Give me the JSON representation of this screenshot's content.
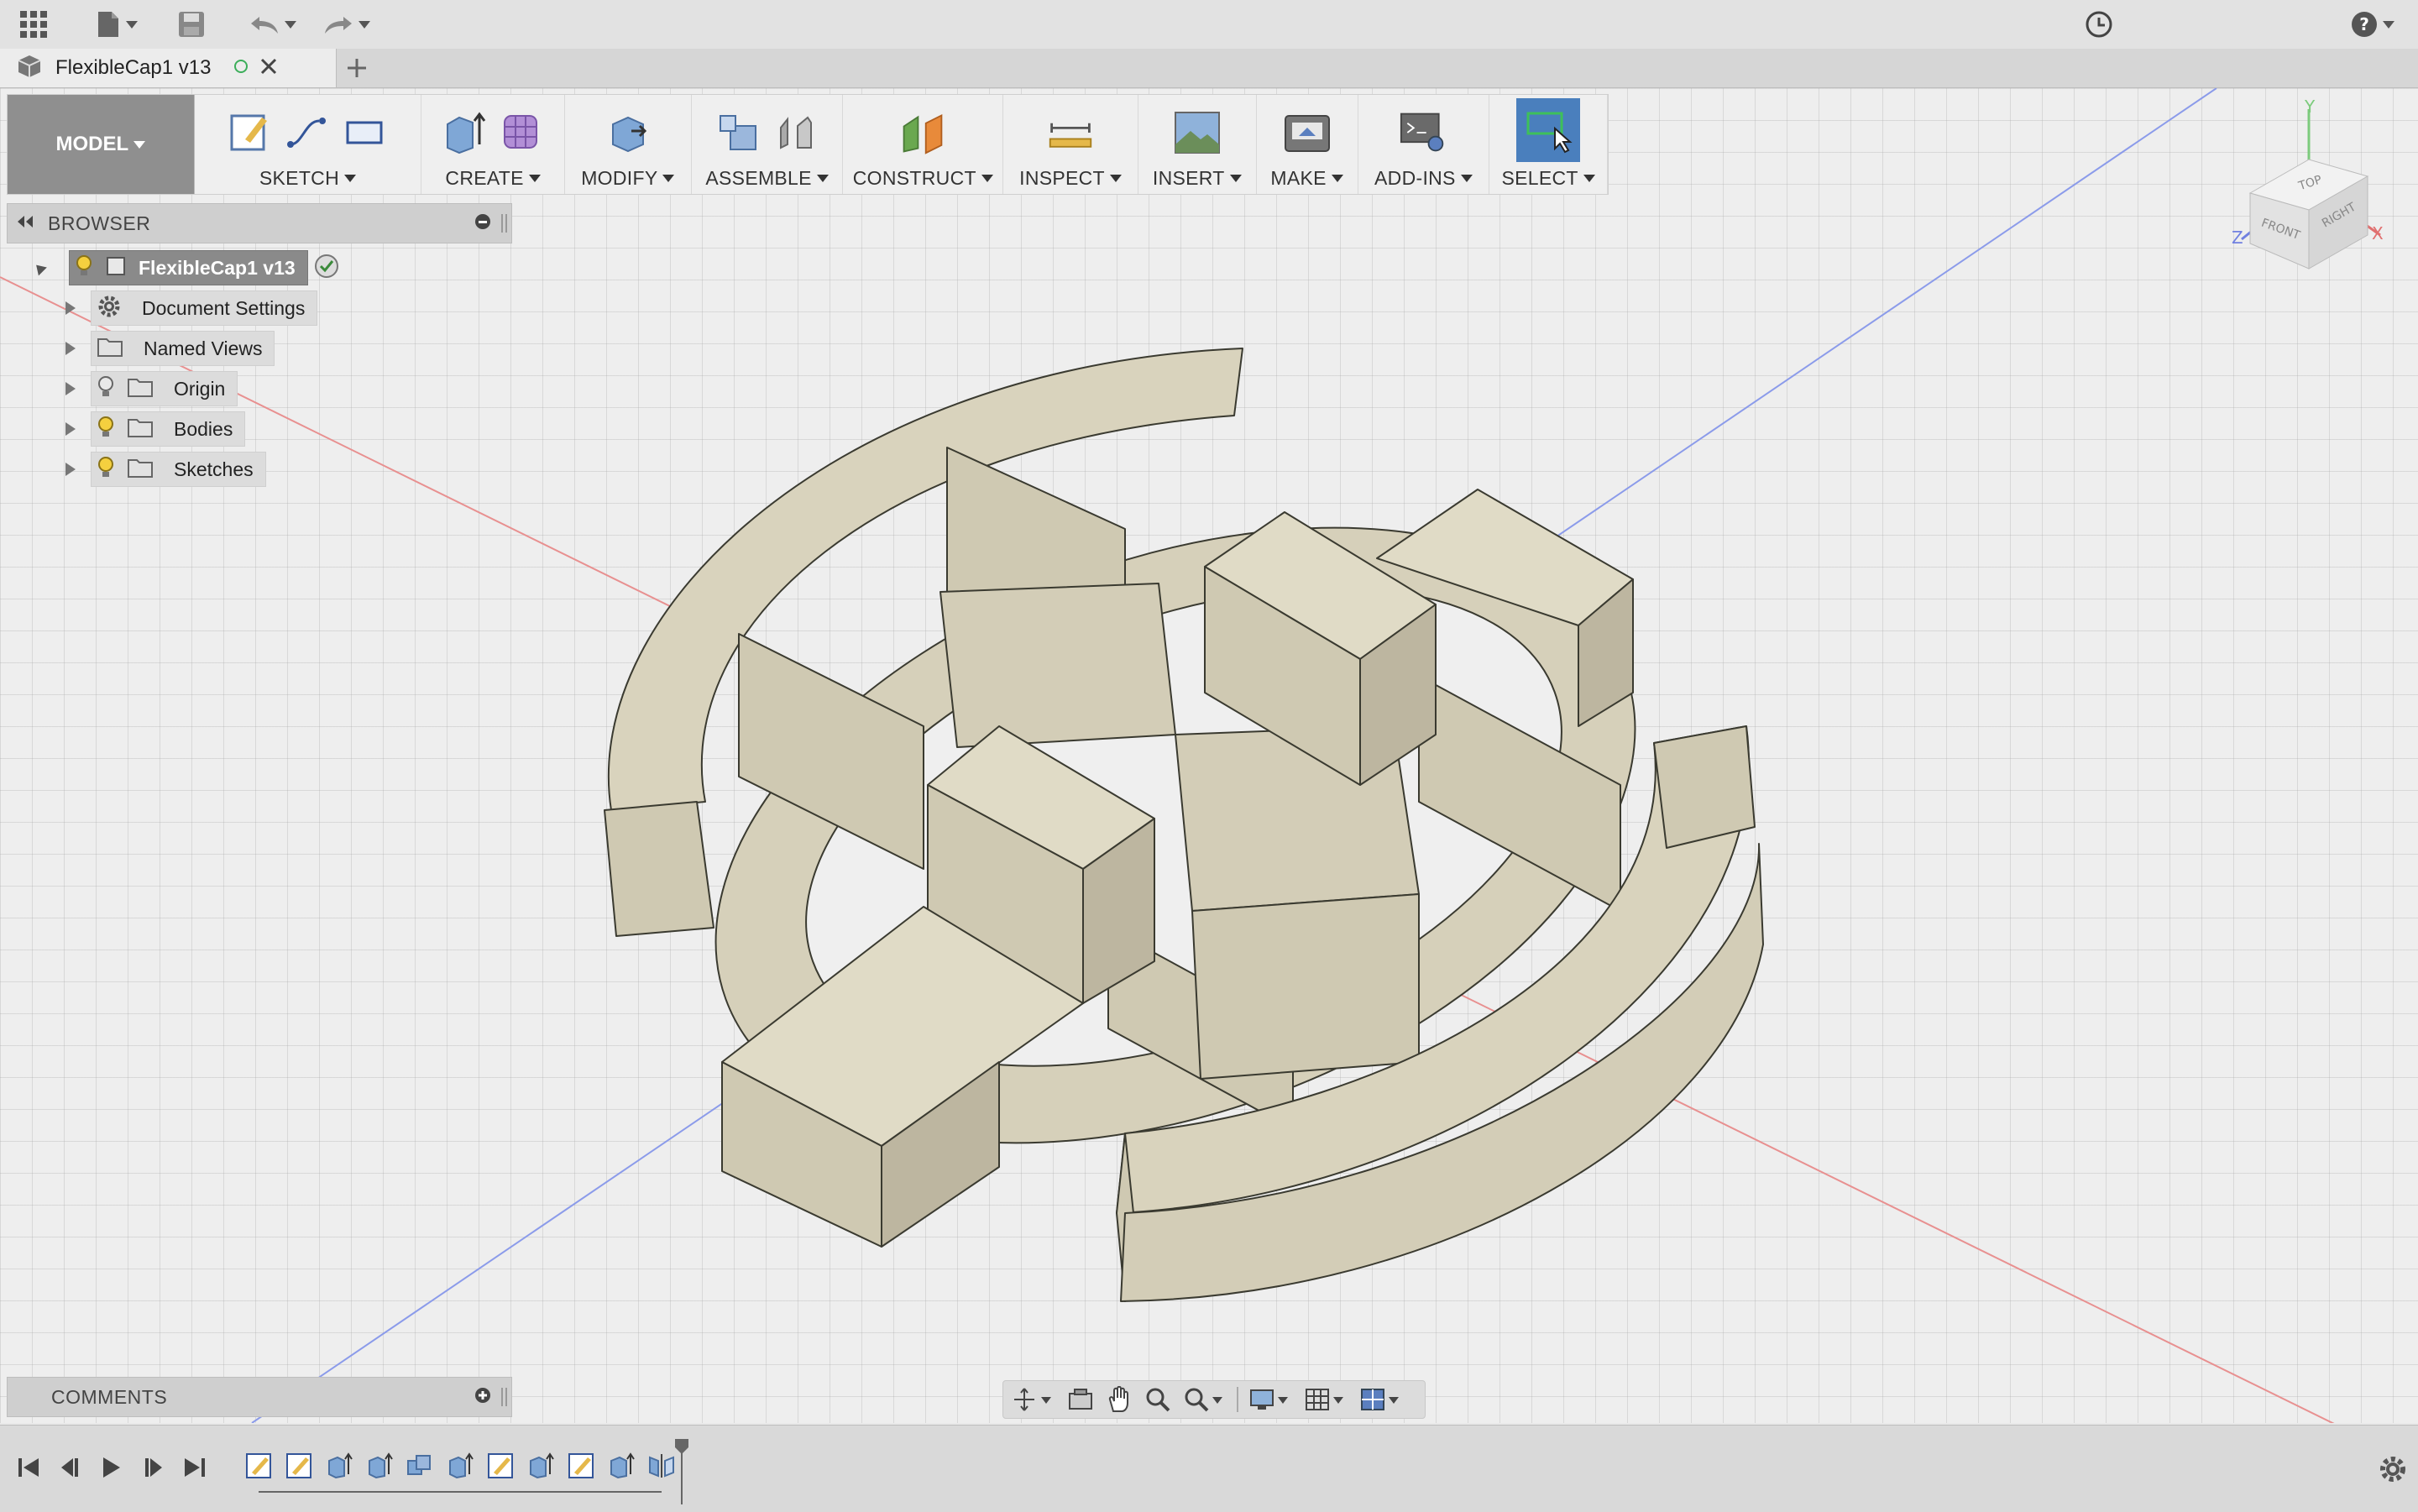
{
  "document": {
    "tab_title": "FlexibleCap1 v13"
  },
  "toolbar": {
    "workspace": "MODEL",
    "groups": [
      {
        "label": "SKETCH"
      },
      {
        "label": "CREATE"
      },
      {
        "label": "MODIFY"
      },
      {
        "label": "ASSEMBLE"
      },
      {
        "label": "CONSTRUCT"
      },
      {
        "label": "INSPECT"
      },
      {
        "label": "INSERT"
      },
      {
        "label": "MAKE"
      },
      {
        "label": "ADD-INS"
      },
      {
        "label": "SELECT"
      }
    ]
  },
  "browser": {
    "title": "BROWSER",
    "root": "FlexibleCap1 v13",
    "items": [
      {
        "label": "Document Settings",
        "icon": "gear-icon"
      },
      {
        "label": "Named Views",
        "icon": "folder-icon"
      },
      {
        "label": "Origin",
        "icon": "folder-icon"
      },
      {
        "label": "Bodies",
        "icon": "folder-icon"
      },
      {
        "label": "Sketches",
        "icon": "folder-icon"
      }
    ]
  },
  "comments": {
    "title": "COMMENTS"
  },
  "viewcube": {
    "top": "TOP",
    "front": "FRONT",
    "right": "RIGHT",
    "axes": {
      "x": "X",
      "y": "Y",
      "z": "Z"
    }
  },
  "colors": {
    "model": "#e0dbc6",
    "model_shade": "#cfc9b2",
    "model_dark": "#bdb6a0",
    "select_active": "#4a7fbd",
    "axis_red": "#e06060",
    "axis_blue": "#6a7fe0"
  }
}
